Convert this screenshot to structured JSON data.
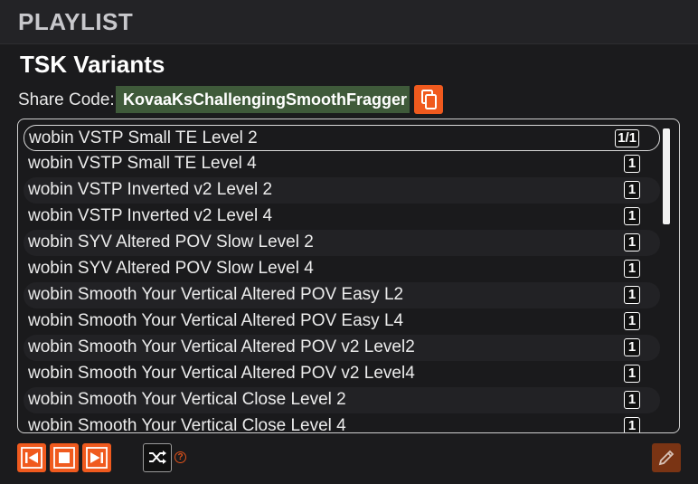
{
  "header": {
    "title": "PLAYLIST"
  },
  "playlist": {
    "name": "TSK Variants",
    "share_label": "Share Code:",
    "share_code": "KovaaKsChallengingSmoothFragger"
  },
  "items": [
    {
      "name": "wobin VSTP Small TE Level 2",
      "count": "1/1"
    },
    {
      "name": "wobin VSTP Small TE Level 4",
      "count": "1"
    },
    {
      "name": "wobin VSTP Inverted v2 Level 2",
      "count": "1"
    },
    {
      "name": "wobin VSTP Inverted v2 Level 4",
      "count": "1"
    },
    {
      "name": "wobin SYV Altered POV Slow Level 2",
      "count": "1"
    },
    {
      "name": "wobin SYV Altered POV Slow Level 4",
      "count": "1"
    },
    {
      "name": "wobin Smooth Your Vertical Altered POV Easy L2",
      "count": "1"
    },
    {
      "name": "wobin Smooth Your Vertical Altered POV Easy L4",
      "count": "1"
    },
    {
      "name": "wobin Smooth Your Vertical Altered POV v2 Level2",
      "count": "1"
    },
    {
      "name": "wobin Smooth Your Vertical Altered POV v2 Level4",
      "count": "1"
    },
    {
      "name": "wobin Smooth Your Vertical Close Level 2",
      "count": "1"
    },
    {
      "name": "wobin Smooth Your Vertical Close Level 4",
      "count": "1"
    }
  ],
  "icons": {
    "copy": "copy-icon",
    "prev": "skip-previous-icon",
    "stop": "stop-icon",
    "next": "skip-next-icon",
    "shuffle": "shuffle-icon",
    "help": "help-icon",
    "edit": "pencil-icon"
  },
  "help_glyph": "?",
  "colors": {
    "accent": "#f05a1e",
    "share_code_bg": "#3f5a3a",
    "edit_bg": "#7a3414",
    "background": "#1b1b1d"
  }
}
